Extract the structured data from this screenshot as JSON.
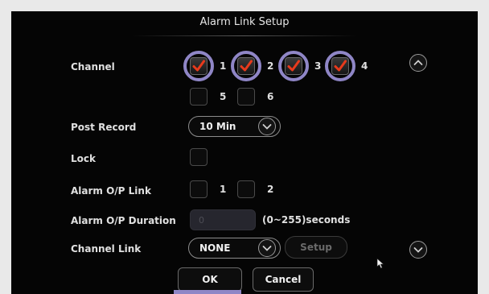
{
  "dialog": {
    "title": "Alarm Link Setup"
  },
  "channel": {
    "label": "Channel",
    "options": [
      {
        "number": "1",
        "checked": true
      },
      {
        "number": "2",
        "checked": true
      },
      {
        "number": "3",
        "checked": true
      },
      {
        "number": "4",
        "checked": true
      },
      {
        "number": "5",
        "checked": false
      },
      {
        "number": "6",
        "checked": false
      }
    ]
  },
  "post_record": {
    "label": "Post Record",
    "value": "10 Min"
  },
  "lock": {
    "label": "Lock",
    "checked": false
  },
  "alarm_op_link": {
    "label": "Alarm O/P Link",
    "options": [
      {
        "number": "1",
        "checked": false
      },
      {
        "number": "2",
        "checked": false
      }
    ]
  },
  "alarm_op_duration": {
    "label": "Alarm O/P Duration",
    "placeholder": "0",
    "range_text": "(0~255)seconds"
  },
  "channel_link": {
    "label": "Channel Link",
    "value": "NONE",
    "setup_label": "Setup"
  },
  "buttons": {
    "ok": "OK",
    "cancel": "Cancel"
  },
  "colors": {
    "check": "#e83a1c",
    "highlight_ring": "#8f86c6",
    "background": "#050505"
  },
  "icons": {
    "scroll_up": "chevron-up-icon",
    "scroll_down": "chevron-down-icon",
    "cursor": "mouse-pointer-icon"
  }
}
